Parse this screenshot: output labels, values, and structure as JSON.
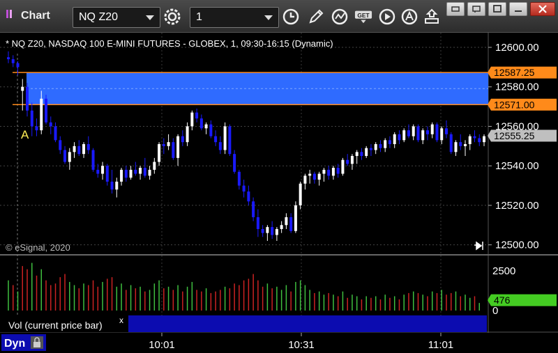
{
  "window": {
    "title": "Chart",
    "symbol": "NQ Z20",
    "interval": "1"
  },
  "chart_info": "* NQ Z20, NASDAQ 100 E-MINI FUTURES - GLOBEX, 1, 09:30-16:15 (Dynamic)",
  "copyright": "© eSignal, 2020",
  "study_label": "Vol (current price bar)",
  "close_study_glyph": "x",
  "mode_label": "Dyn",
  "marker_label": "A",
  "price_labels": {
    "upper_zone": "12587.25",
    "lower_zone": "12571.00",
    "last_price": "12555.25",
    "last_volume": "476"
  },
  "colors": {
    "up_candle": "#ffffff",
    "down_candle": "#1a1aff",
    "zone_fill": "#2f6bff",
    "zone_line": "#ff8a1a",
    "last_price_bg": "#bfbfbf",
    "volume_up": "#3fbf3f",
    "volume_down": "#cc2222",
    "volume_last_bg": "#44cc22"
  },
  "icons": [
    "gear-icon",
    "clock-icon",
    "pencil-icon",
    "line-study-icon",
    "get-icon",
    "play-icon",
    "alert-icon",
    "move-icon"
  ],
  "chart_data": {
    "type": "candlestick",
    "price_axis": {
      "ticks": [
        "12600.00",
        "12580.00",
        "12560.00",
        "12540.00",
        "12520.00",
        "12500.00"
      ],
      "range": [
        12496,
        12606
      ]
    },
    "volume_axis": {
      "ticks": [
        "2500",
        "0"
      ],
      "range": [
        0,
        3200
      ]
    },
    "time_axis": {
      "ticks": [
        "10:01",
        "10:31",
        "11:01"
      ]
    },
    "zone": {
      "high": 12587.25,
      "low": 12571.0
    },
    "candles": [
      [
        12595,
        12598,
        12592,
        12594
      ],
      [
        12594,
        12596,
        12590,
        12592
      ],
      [
        12592,
        12593,
        12586,
        12590
      ],
      [
        12578,
        12584,
        12568,
        12580
      ],
      [
        12580,
        12582,
        12565,
        12568
      ],
      [
        12568,
        12572,
        12555,
        12560
      ],
      [
        12560,
        12564,
        12555,
        12558
      ],
      [
        12558,
        12578,
        12556,
        12574
      ],
      [
        12574,
        12576,
        12561,
        12562
      ],
      [
        12562,
        12565,
        12556,
        12560
      ],
      [
        12560,
        12562,
        12552,
        12553
      ],
      [
        12553,
        12555,
        12546,
        12548
      ],
      [
        12548,
        12550,
        12541,
        12542
      ],
      [
        12542,
        12549,
        12538,
        12547
      ],
      [
        12547,
        12552,
        12544,
        12550
      ],
      [
        12550,
        12553,
        12545,
        12546
      ],
      [
        12546,
        12552,
        12544,
        12551
      ],
      [
        12551,
        12555,
        12546,
        12548
      ],
      [
        12548,
        12549,
        12537,
        12538
      ],
      [
        12538,
        12541,
        12534,
        12536
      ],
      [
        12536,
        12542,
        12533,
        12540
      ],
      [
        12540,
        12541,
        12530,
        12532
      ],
      [
        12532,
        12538,
        12526,
        12528
      ],
      [
        12528,
        12534,
        12524,
        12532
      ],
      [
        12532,
        12539,
        12530,
        12538
      ],
      [
        12538,
        12540,
        12532,
        12534
      ],
      [
        12534,
        12540,
        12533,
        12538
      ],
      [
        12538,
        12542,
        12535,
        12536
      ],
      [
        12536,
        12540,
        12533,
        12539
      ],
      [
        12539,
        12544,
        12534,
        12535
      ],
      [
        12535,
        12540,
        12533,
        12538
      ],
      [
        12538,
        12544,
        12536,
        12542
      ],
      [
        12542,
        12552,
        12540,
        12551
      ],
      [
        12551,
        12554,
        12546,
        12550
      ],
      [
        12550,
        12556,
        12548,
        12552
      ],
      [
        12552,
        12554,
        12543,
        12544
      ],
      [
        12544,
        12556,
        12540,
        12555
      ],
      [
        12555,
        12558,
        12550,
        12552
      ],
      [
        12552,
        12562,
        12550,
        12560
      ],
      [
        12560,
        12568,
        12558,
        12567
      ],
      [
        12567,
        12569,
        12562,
        12564
      ],
      [
        12564,
        12566,
        12558,
        12559
      ],
      [
        12559,
        12562,
        12556,
        12561
      ],
      [
        12561,
        12563,
        12554,
        12555
      ],
      [
        12555,
        12558,
        12550,
        12552
      ],
      [
        12552,
        12555,
        12546,
        12548
      ],
      [
        12548,
        12562,
        12546,
        12560
      ],
      [
        12560,
        12561,
        12545,
        12546
      ],
      [
        12546,
        12548,
        12536,
        12537
      ],
      [
        12537,
        12538,
        12528,
        12530
      ],
      [
        12530,
        12533,
        12524,
        12527
      ],
      [
        12527,
        12530,
        12520,
        12522
      ],
      [
        12522,
        12524,
        12512,
        12514
      ],
      [
        12514,
        12518,
        12504,
        12508
      ],
      [
        12508,
        12510,
        12504,
        12506
      ],
      [
        12506,
        12510,
        12502,
        12509
      ],
      [
        12509,
        12512,
        12503,
        12505
      ],
      [
        12505,
        12509,
        12502,
        12508
      ],
      [
        12508,
        12512,
        12506,
        12510
      ],
      [
        12510,
        12516,
        12508,
        12514
      ],
      [
        12514,
        12516,
        12506,
        12507
      ],
      [
        12507,
        12522,
        12506,
        12520
      ],
      [
        12520,
        12532,
        12518,
        12531
      ],
      [
        12531,
        12536,
        12528,
        12535
      ],
      [
        12535,
        12538,
        12531,
        12536
      ],
      [
        12536,
        12537,
        12531,
        12533
      ],
      [
        12533,
        12537,
        12530,
        12536
      ],
      [
        12536,
        12539,
        12532,
        12538
      ],
      [
        12538,
        12540,
        12533,
        12535
      ],
      [
        12535,
        12540,
        12533,
        12539
      ],
      [
        12539,
        12541,
        12534,
        12536
      ],
      [
        12536,
        12544,
        12535,
        12543
      ],
      [
        12543,
        12546,
        12540,
        12541
      ],
      [
        12541,
        12546,
        12538,
        12545
      ],
      [
        12545,
        12548,
        12541,
        12547
      ],
      [
        12547,
        12549,
        12543,
        12545
      ],
      [
        12545,
        12550,
        12544,
        12549
      ],
      [
        12549,
        12551,
        12545,
        12548
      ],
      [
        12548,
        12552,
        12546,
        12551
      ],
      [
        12551,
        12553,
        12547,
        12549
      ],
      [
        12549,
        12554,
        12547,
        12553
      ],
      [
        12553,
        12555,
        12549,
        12551
      ],
      [
        12551,
        12557,
        12549,
        12556
      ],
      [
        12556,
        12558,
        12551,
        12553
      ],
      [
        12553,
        12559,
        12552,
        12558
      ],
      [
        12558,
        12561,
        12554,
        12555
      ],
      [
        12555,
        12561,
        12553,
        12560
      ],
      [
        12560,
        12561,
        12552,
        12553
      ],
      [
        12553,
        12559,
        12551,
        12558
      ],
      [
        12558,
        12560,
        12553,
        12556
      ],
      [
        12556,
        12562,
        12554,
        12561
      ],
      [
        12561,
        12562,
        12552,
        12553
      ],
      [
        12553,
        12560,
        12551,
        12559
      ],
      [
        12559,
        12563,
        12554,
        12556
      ],
      [
        12556,
        12557,
        12546,
        12547
      ],
      [
        12547,
        12553,
        12545,
        12552
      ],
      [
        12552,
        12556,
        12548,
        12550
      ],
      [
        12550,
        12553,
        12545,
        12551
      ],
      [
        12551,
        12556,
        12548,
        12555
      ],
      [
        12555,
        12558,
        12552,
        12554
      ],
      [
        12554,
        12556,
        12550,
        12552
      ],
      [
        12552,
        12556,
        12550,
        12555
      ]
    ],
    "volume": [
      [
        1900,
        1
      ],
      [
        1600,
        0
      ],
      [
        1200,
        1
      ],
      [
        2800,
        0
      ],
      [
        2600,
        0
      ],
      [
        3000,
        1
      ],
      [
        2200,
        0
      ],
      [
        2600,
        1
      ],
      [
        1900,
        0
      ],
      [
        1600,
        0
      ],
      [
        1700,
        0
      ],
      [
        2100,
        0
      ],
      [
        2300,
        0
      ],
      [
        1800,
        1
      ],
      [
        1600,
        1
      ],
      [
        1400,
        0
      ],
      [
        1700,
        1
      ],
      [
        1600,
        0
      ],
      [
        1900,
        0
      ],
      [
        1500,
        0
      ],
      [
        1800,
        1
      ],
      [
        2000,
        0
      ],
      [
        2100,
        0
      ],
      [
        1500,
        1
      ],
      [
        1700,
        1
      ],
      [
        1300,
        0
      ],
      [
        1600,
        1
      ],
      [
        1400,
        0
      ],
      [
        1500,
        1
      ],
      [
        1200,
        0
      ],
      [
        1300,
        1
      ],
      [
        1700,
        1
      ],
      [
        1900,
        1
      ],
      [
        1400,
        0
      ],
      [
        1500,
        1
      ],
      [
        1300,
        0
      ],
      [
        1600,
        1
      ],
      [
        1200,
        0
      ],
      [
        1500,
        1
      ],
      [
        1800,
        1
      ],
      [
        1300,
        0
      ],
      [
        1200,
        0
      ],
      [
        1400,
        1
      ],
      [
        1100,
        0
      ],
      [
        1200,
        0
      ],
      [
        1300,
        0
      ],
      [
        1500,
        1
      ],
      [
        1400,
        0
      ],
      [
        1700,
        0
      ],
      [
        1600,
        0
      ],
      [
        1900,
        0
      ],
      [
        2000,
        0
      ],
      [
        2300,
        0
      ],
      [
        1900,
        0
      ],
      [
        1500,
        0
      ],
      [
        1700,
        1
      ],
      [
        1400,
        0
      ],
      [
        1500,
        1
      ],
      [
        1300,
        1
      ],
      [
        1600,
        1
      ],
      [
        1200,
        0
      ],
      [
        1800,
        1
      ],
      [
        1900,
        1
      ],
      [
        1600,
        1
      ],
      [
        1300,
        1
      ],
      [
        1100,
        0
      ],
      [
        1200,
        1
      ],
      [
        1000,
        1
      ],
      [
        1100,
        0
      ],
      [
        1000,
        1
      ],
      [
        900,
        0
      ],
      [
        1200,
        1
      ],
      [
        800,
        0
      ],
      [
        1000,
        1
      ],
      [
        900,
        1
      ],
      [
        700,
        0
      ],
      [
        900,
        1
      ],
      [
        800,
        0
      ],
      [
        900,
        1
      ],
      [
        700,
        0
      ],
      [
        1000,
        1
      ],
      [
        800,
        0
      ],
      [
        900,
        1
      ],
      [
        700,
        0
      ],
      [
        1000,
        1
      ],
      [
        1100,
        0
      ],
      [
        1200,
        1
      ],
      [
        1100,
        0
      ],
      [
        1000,
        1
      ],
      [
        900,
        0
      ],
      [
        1200,
        1
      ],
      [
        1100,
        0
      ],
      [
        1300,
        1
      ],
      [
        1000,
        0
      ],
      [
        1100,
        0
      ],
      [
        1200,
        1
      ],
      [
        900,
        0
      ],
      [
        1000,
        1
      ],
      [
        800,
        1
      ],
      [
        900,
        0
      ],
      [
        476,
        1
      ]
    ]
  }
}
